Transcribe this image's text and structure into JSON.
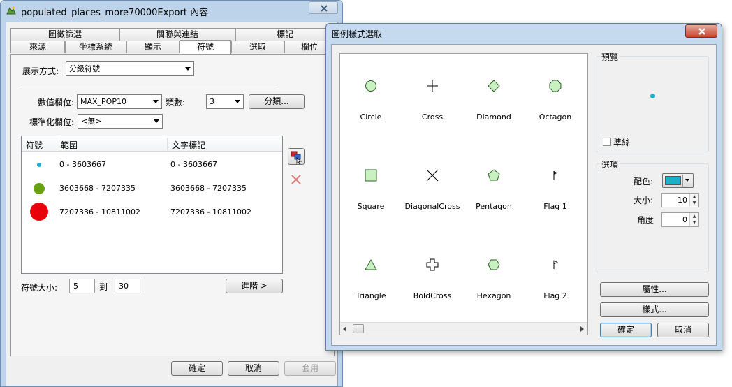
{
  "main_window": {
    "title": "populated_places_more70000Export 內容",
    "tabs_row1": [
      "圖徵篩選",
      "關聯與連結",
      "標記"
    ],
    "tabs_row2": [
      "來源",
      "坐標系統",
      "顯示",
      "符號",
      "選取",
      "欄位"
    ],
    "active_tab": "符號",
    "display_mode_label": "展示方式:",
    "display_mode_value": "分級符號",
    "value_field_label": "數值欄位:",
    "value_field_value": "MAX_POP10",
    "classes_label": "類數:",
    "classes_value": "3",
    "classify_button": "分類...",
    "normalize_label": "標準化欄位:",
    "normalize_value": "<無>",
    "table": {
      "headers": [
        "符號",
        "範圍",
        "文字標記"
      ],
      "rows": [
        {
          "range": "0 - 3603667",
          "label": "0 - 3603667",
          "color": "#1ab0c8"
        },
        {
          "range": "3603668 - 7207335",
          "label": "3603668 - 7207335",
          "color": "#6aa110"
        },
        {
          "range": "7207336 - 10811002",
          "label": "7207336 - 10811002",
          "color": "#e8000a"
        }
      ]
    },
    "size_label": "符號大小:",
    "size_from": "5",
    "size_to_label": "到",
    "size_to": "30",
    "advanced_button": "進階 >",
    "ok_button": "確定",
    "cancel_button": "取消",
    "apply_button": "套用"
  },
  "symbol_dialog": {
    "title": "圖例樣式選取",
    "symbols": [
      {
        "name": "Circle",
        "icon": "circle-icon"
      },
      {
        "name": "Cross",
        "icon": "cross-icon"
      },
      {
        "name": "Diamond",
        "icon": "diamond-icon"
      },
      {
        "name": "Octagon",
        "icon": "octagon-icon"
      },
      {
        "name": "Square",
        "icon": "square-icon"
      },
      {
        "name": "DiagonalCross",
        "icon": "diagonal-cross-icon"
      },
      {
        "name": "Pentagon",
        "icon": "pentagon-icon"
      },
      {
        "name": "Flag 1",
        "icon": "flag-icon"
      },
      {
        "name": "Triangle",
        "icon": "triangle-icon"
      },
      {
        "name": "BoldCross",
        "icon": "bold-cross-icon"
      },
      {
        "name": "Hexagon",
        "icon": "hexagon-icon"
      },
      {
        "name": "Flag 2",
        "icon": "flag-icon"
      }
    ],
    "preview_label": "預覽",
    "crosshair_label": "準絲",
    "options_label": "選項",
    "color_label": "配色:",
    "color_value": "#1ab0c8",
    "size_label": "大小:",
    "size_value": "10",
    "angle_label": "角度",
    "angle_value": "0",
    "properties_button": "屬性...",
    "styles_button": "樣式...",
    "ok_button": "確定",
    "cancel_button": "取消"
  }
}
